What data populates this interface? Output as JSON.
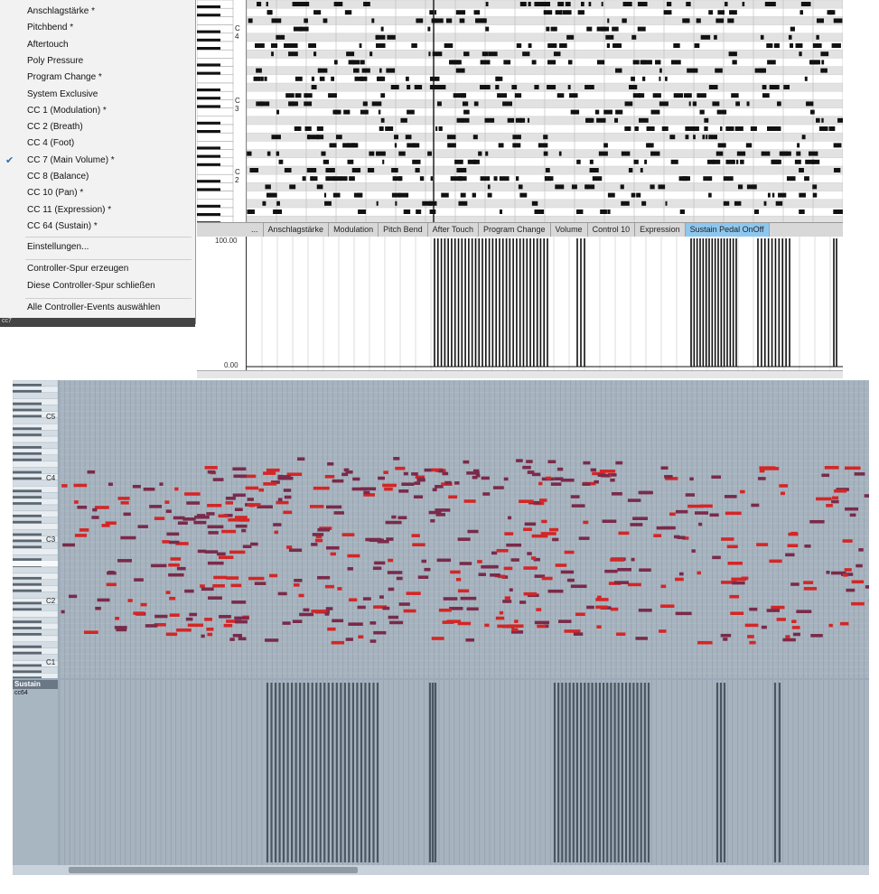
{
  "context_menu": {
    "items": [
      {
        "label": "Anschlagstärke *",
        "checked": false
      },
      {
        "label": "Pitchbend *",
        "checked": false
      },
      {
        "label": "Aftertouch",
        "checked": false
      },
      {
        "label": "Poly Pressure",
        "checked": false
      },
      {
        "label": "Program Change *",
        "checked": false
      },
      {
        "label": "System Exclusive",
        "checked": false
      },
      {
        "label": "CC 1  (Modulation) *",
        "checked": false
      },
      {
        "label": "CC 2  (Breath)",
        "checked": false
      },
      {
        "label": "CC 4  (Foot)",
        "checked": false
      },
      {
        "label": "CC 7  (Main Volume) *",
        "checked": true
      },
      {
        "label": "CC 8  (Balance)",
        "checked": false
      },
      {
        "label": "CC 10  (Pan) *",
        "checked": false
      },
      {
        "label": "CC 11  (Expression) *",
        "checked": false
      },
      {
        "label": "CC 64  (Sustain) *",
        "checked": false
      }
    ],
    "settings": "Einstellungen...",
    "create_lane": "Controller-Spur erzeugen",
    "close_lane": "Diese Controller-Spur schließen",
    "select_all": "Alle Controller-Events auswählen",
    "footer_label": "cc7",
    "check_glyph": "✔"
  },
  "top_editor": {
    "key_labels": {
      "c4": "C 4",
      "c3": "C 3",
      "c2": "C 2"
    },
    "tabs": [
      {
        "label": "...",
        "active": false
      },
      {
        "label": "Anschlagstärke",
        "active": false
      },
      {
        "label": "Modulation",
        "active": false
      },
      {
        "label": "Pitch Bend",
        "active": false
      },
      {
        "label": "After Touch",
        "active": false
      },
      {
        "label": "Program Change",
        "active": false
      },
      {
        "label": "Volume",
        "active": false
      },
      {
        "label": "Control 10",
        "active": false
      },
      {
        "label": "Expression",
        "active": false
      },
      {
        "label": "Sustain Pedal OnOff",
        "active": true
      }
    ],
    "ctl_max": "100.00",
    "ctl_min": "0.00",
    "note_color": "#111111",
    "grid_color": "#c8c8c8"
  },
  "bottom_editor": {
    "key_labels": {
      "c5": "C5",
      "c4": "C4",
      "c3": "C3",
      "c2": "C2",
      "c1": "C1"
    },
    "ctl_title": "Sustain",
    "ctl_cc": "cc64",
    "bg_color": "#9aaab8",
    "note_color_red": "#d42626",
    "note_color_purple": "#7a2a4a",
    "ctl_color": "#4a5660"
  }
}
